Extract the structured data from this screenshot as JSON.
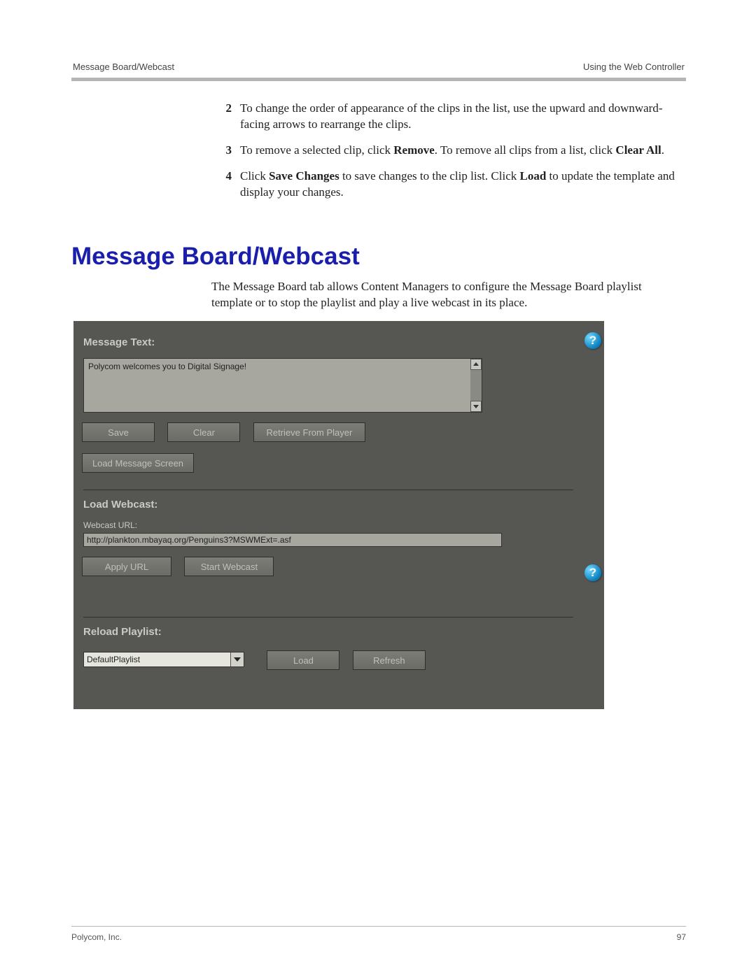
{
  "header": {
    "left": "Message Board/Webcast",
    "right": "Using the Web Controller"
  },
  "steps": [
    {
      "num": "2",
      "html": "To change the order of appearance of the clips in the list, use the upward and downward-facing arrows to rearrange the clips."
    },
    {
      "num": "3",
      "html": "To remove a selected clip, click <b>Remove</b>. To remove all clips from a list, click <b>Clear All</b>."
    },
    {
      "num": "4",
      "html": "Click <b>Save Changes</b> to save changes to the clip list. Click <b>Load</b> to update the template and display your changes."
    }
  ],
  "title": "Message Board/Webcast",
  "intro": "The Message Board tab allows Content Managers to configure the Message Board playlist template or to stop the playlist and play a live webcast in its place.",
  "panel": {
    "message_text_heading": "Message Text:",
    "message_value": "Polycom welcomes you to Digital Signage!",
    "save_label": "Save",
    "clear_label": "Clear",
    "retrieve_label": "Retrieve From Player",
    "load_msg_label": "Load Message Screen",
    "load_webcast_heading": "Load Webcast:",
    "webcast_url_label": "Webcast URL:",
    "webcast_url_value": "http://plankton.mbayaq.org/Penguins3?MSWMExt=.asf",
    "apply_url_label": "Apply URL",
    "start_webcast_label": "Start Webcast",
    "reload_playlist_heading": "Reload Playlist:",
    "playlist_selected": "DefaultPlaylist",
    "load_label": "Load",
    "refresh_label": "Refresh"
  },
  "footer": {
    "left": "Polycom, Inc.",
    "right": "97"
  }
}
